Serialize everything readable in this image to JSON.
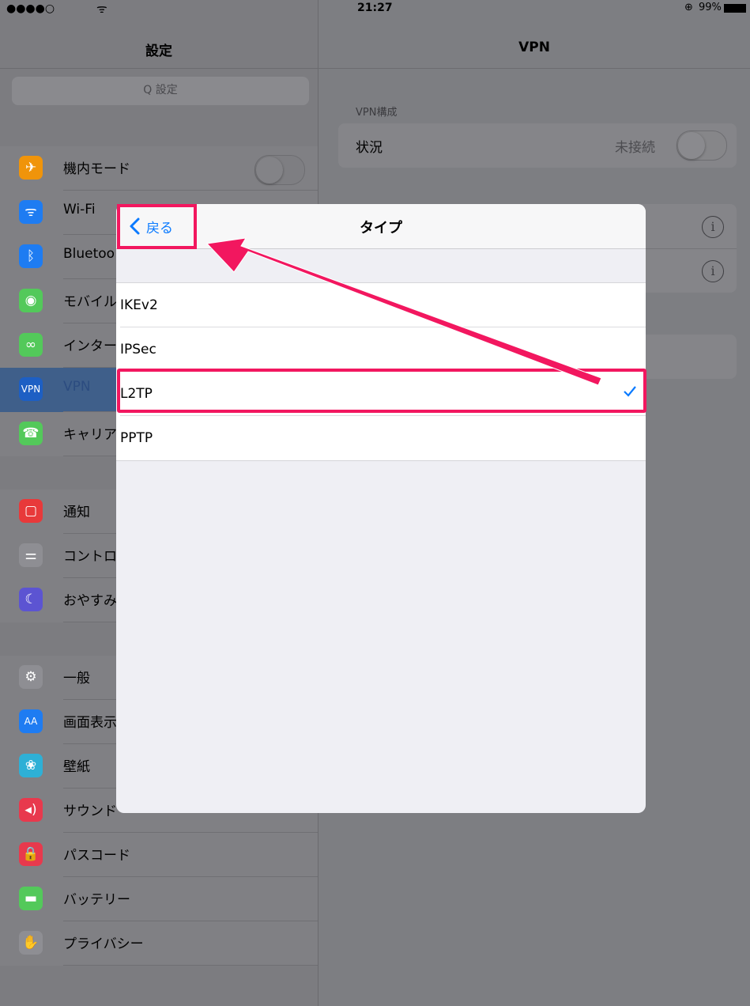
{
  "status_bar": {
    "signal": "●●●●○",
    "wifi": "ᯤ",
    "time": "21:27",
    "lock_icon": "rotation-lock-icon",
    "battery": "99%"
  },
  "settings": {
    "title": "設定",
    "search_placeholder": "Q 設定",
    "items": [
      {
        "label": "機内モード",
        "icon": "airplane-icon",
        "color": "#f0940a"
      },
      {
        "label": "Wi-Fi",
        "icon": "wifi-icon",
        "color": "#1e7cf2"
      },
      {
        "label": "Bluetoo",
        "icon": "bluetooth-icon",
        "color": "#1e7cf2"
      },
      {
        "label": "モバイル",
        "icon": "antenna-icon",
        "color": "#53c95a"
      },
      {
        "label": "インター",
        "icon": "link-icon",
        "color": "#53c95a"
      },
      {
        "label": "VPN",
        "icon": "vpn-icon",
        "color": "#1d5fc4"
      },
      {
        "label": "キャリア",
        "icon": "phone-icon",
        "color": "#53c95a"
      },
      {
        "label": "通知",
        "icon": "notification-icon",
        "color": "#e8393a"
      },
      {
        "label": "コントロ",
        "icon": "control-center-icon",
        "color": "#8e8e93"
      },
      {
        "label": "おやすみ",
        "icon": "moon-icon",
        "color": "#5c54d2"
      },
      {
        "label": "一般",
        "icon": "gear-icon",
        "color": "#8e8e93"
      },
      {
        "label": "画面表示",
        "icon": "text-size-icon",
        "color": "#1e7cf2"
      },
      {
        "label": "壁紙",
        "icon": "wallpaper-icon",
        "color": "#2eb0d6"
      },
      {
        "label": "サウンド",
        "icon": "speaker-icon",
        "color": "#e8394d"
      },
      {
        "label": "パスコード",
        "icon": "lock-icon",
        "color": "#e8394d"
      },
      {
        "label": "バッテリー",
        "icon": "battery-icon",
        "color": "#53c95a"
      },
      {
        "label": "プライバシー",
        "icon": "hand-icon",
        "color": "#8e8e93"
      }
    ]
  },
  "vpn": {
    "title": "VPN",
    "section_header": "VPN構成",
    "status_label": "状況",
    "status_value": "未接続"
  },
  "type_modal": {
    "title": "タイプ",
    "back_label": "戻る",
    "options": [
      "IKEv2",
      "IPSec",
      "L2TP",
      "PPTP"
    ],
    "selected": "L2TP"
  },
  "colors": {
    "accent": "#0a7aff",
    "highlight": "#f2175f"
  }
}
